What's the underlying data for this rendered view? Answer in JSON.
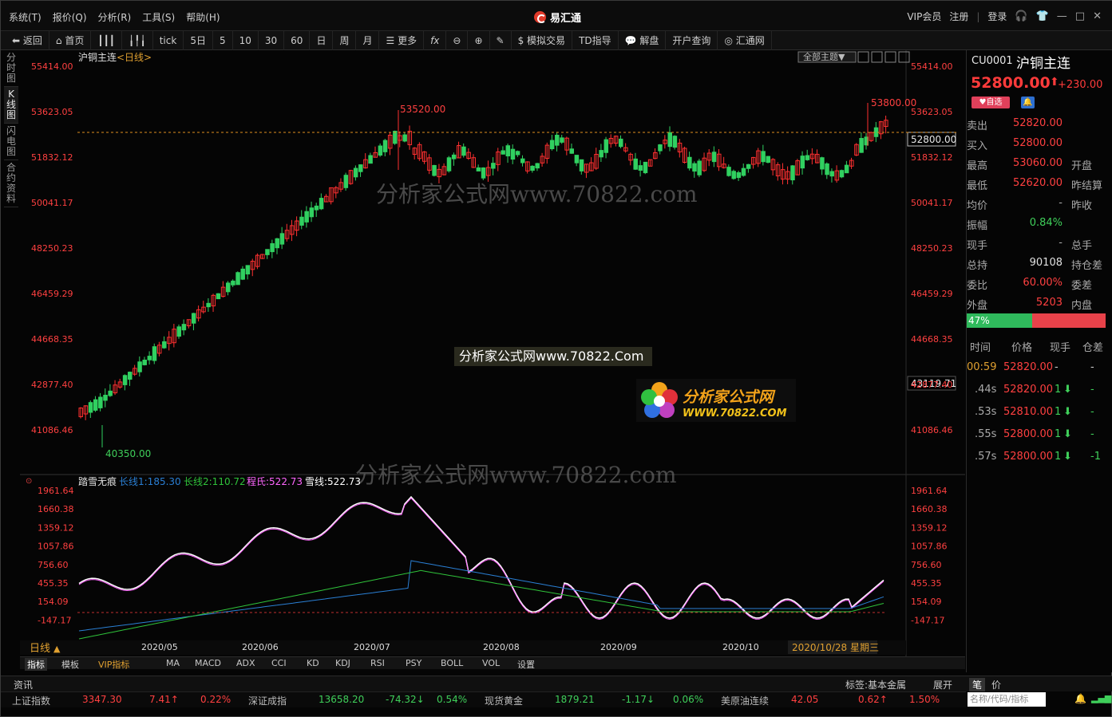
{
  "menubar": {
    "items": [
      "系统(T)",
      "报价(Q)",
      "分析(R)",
      "工具(S)",
      "帮助(H)"
    ],
    "app_title": "易汇通",
    "right": [
      "VIP会员",
      "注册",
      "登录"
    ]
  },
  "toolbar": {
    "items": [
      "返回",
      "首页",
      "tick",
      "5日",
      "5",
      "10",
      "30",
      "60",
      "日",
      "周",
      "月",
      "更多",
      "fx",
      "模拟交易",
      "TD指导",
      "解盘",
      "开户查询",
      "汇通网"
    ]
  },
  "left_tabs": [
    "分时图",
    "K线图",
    "闪电图",
    "合约资料"
  ],
  "chart": {
    "title": "沪铜主连",
    "period": "<日线>",
    "theme_btn": "全部主题▼",
    "y_ticks": [
      "55414.00",
      "53623.05",
      "51832.12",
      "50041.17",
      "48250.23",
      "46459.29",
      "44668.35",
      "42877.40",
      "41086.46"
    ],
    "high_label": "53520.00",
    "high2_label": "53800.00",
    "low_label": "40350.00",
    "current_tag": "52800.00",
    "cursor_tag": "43119.71",
    "watermark": "分析家公式网www.70822.com",
    "wm_box": "分析家公式网www.70822.Com",
    "logo_cn": "分析家公式网",
    "logo_url": "WWW.70822.COM",
    "watermark2": "分析家公式网www.70822.com"
  },
  "indicator": {
    "name": "踏雪无痕",
    "lines": [
      {
        "label": "长线1:185.30",
        "color": "#2a7fd4"
      },
      {
        "label": "长线2:110.72",
        "color": "#2fc23a"
      },
      {
        "label": "程氏:522.73",
        "color": "#ff66ff"
      },
      {
        "label": "雪线:522.73",
        "color": "#ffffff"
      }
    ],
    "y_ticks": [
      "1961.64",
      "1660.38",
      "1359.12",
      "1057.86",
      "756.60",
      "455.35",
      "154.09",
      "-147.17"
    ]
  },
  "xaxis": {
    "period_btn": "日线",
    "labels": [
      "2020/05",
      "2020/06",
      "2020/07",
      "2020/08",
      "2020/09",
      "2020/10"
    ],
    "cursor_date": "2020/10/28 星期三"
  },
  "bottom_tabs": [
    "指标",
    "模板",
    "VIP指标",
    "MA",
    "MACD",
    "ADX",
    "CCI",
    "KD",
    "KDJ",
    "RSI",
    "PSY",
    "BOLL",
    "VOL",
    "设置"
  ],
  "info": {
    "left": "资讯",
    "tag": "标签:基本金属",
    "expand": "展开"
  },
  "ticker": [
    {
      "name": "上证指数",
      "value": "3347.30",
      "chg": "7.41↑",
      "pct": "0.22%",
      "color": "#ff4040"
    },
    {
      "name": "深证成指",
      "value": "13658.20",
      "chg": "-74.32↓",
      "pct": "0.54%",
      "color": "#3fcf5a"
    },
    {
      "name": "现货黄金",
      "value": "1879.21",
      "chg": "-1.17↓",
      "pct": "0.06%",
      "color": "#3fcf5a"
    },
    {
      "name": "美原油连续",
      "value": "42.05",
      "chg": "0.62↑",
      "pct": "1.50%",
      "color": "#ff4040"
    }
  ],
  "quote": {
    "code": "CU0001",
    "name": "沪铜主连",
    "price": "52800.00",
    "change": "+230.00",
    "fav": "自选",
    "rows": [
      {
        "l": "卖出",
        "v": "52820.00",
        "vc": "#ff4040",
        "r": ""
      },
      {
        "l": "买入",
        "v": "52800.00",
        "vc": "#ff4040",
        "r": ""
      },
      {
        "l": "最高",
        "v": "53060.00",
        "vc": "#ff4040",
        "r": "开盘"
      },
      {
        "l": "最低",
        "v": "52620.00",
        "vc": "#ff4040",
        "r": "昨结算"
      },
      {
        "l": "均价",
        "v": "-",
        "vc": "#aaaaaa",
        "r": "昨收"
      },
      {
        "l": "振幅",
        "v": "0.84%",
        "vc": "#3fcf5a",
        "r": ""
      },
      {
        "l": "现手",
        "v": "-",
        "vc": "#aaaaaa",
        "r": "总手"
      },
      {
        "l": "总持",
        "v": "90108",
        "vc": "#e0e0e0",
        "r": "持仓差"
      },
      {
        "l": "委比",
        "v": "60.00%",
        "vc": "#ff4040",
        "r": "委差"
      },
      {
        "l": "外盘",
        "v": "5203",
        "vc": "#ff4040",
        "r": "内盘"
      }
    ],
    "buy_ratio": 0.47,
    "buy_ratio_label": "47%",
    "trade_head": [
      "时间",
      "价格",
      "现手",
      "仓差"
    ],
    "trades": [
      {
        "t": "00:59",
        "p": "52820.00",
        "h": "-",
        "d": "-"
      },
      {
        "t": ".44s",
        "p": "52820.00",
        "h": "1",
        "d": "-"
      },
      {
        "t": ".53s",
        "p": "52810.00",
        "h": "1",
        "d": "-"
      },
      {
        "t": ".55s",
        "p": "52800.00",
        "h": "1",
        "d": "-"
      },
      {
        "t": ".57s",
        "p": "52800.00",
        "h": "1",
        "d": "-1"
      }
    ],
    "tabs": [
      "笔",
      "价"
    ],
    "search_placeholder": "名称/代码/指标"
  }
}
